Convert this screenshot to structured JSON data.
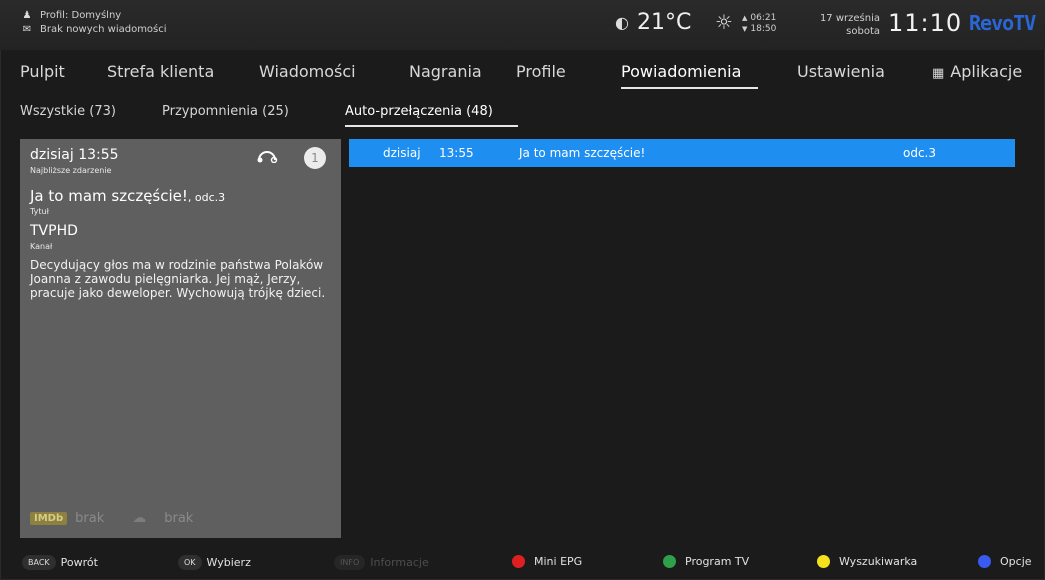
{
  "status": {
    "profile": "Profil: Domyślny",
    "messages": "Brak nowych wiadomości",
    "temperature": "21°C",
    "sunrise": "06:21",
    "sunset": "18:50",
    "date": "17 września",
    "weekday": "sobota",
    "time": "11:10",
    "brand": "RevoTV"
  },
  "nav": {
    "items": [
      "Pulpit",
      "Strefa klienta",
      "Wiadomości",
      "Nagrania",
      "Profile",
      "Powiadomienia",
      "Ustawienia",
      "Aplikacje"
    ],
    "active": "Powiadomienia"
  },
  "subtabs": {
    "items": [
      "Wszystkie (73)",
      "Przypomnienia (25)",
      "Auto-przełączenia (48)"
    ],
    "active": "Auto-przełączenia (48)"
  },
  "detail": {
    "when": "dzisiaj 13:55",
    "when_label": "Najbliższe zdarzenie",
    "title": "Ja to mam szczęście!",
    "episode": ", odc.3",
    "title_label": "Tytuł",
    "channel": "TVPHD",
    "channel_label": "Kanał",
    "description": "Decydujący głos ma w rodzinie państwa Polaków Joanna z zawodu pielęgniarka. Jej mąż, Jerzy, pracuje jako deweloper. Wychowują trójkę dzieci.",
    "badge": "1",
    "imdb_label": "IMDb",
    "imdb_value": "brak",
    "rt_value": "brak"
  },
  "list": {
    "rows": [
      {
        "day": "dzisiaj",
        "time": "13:55",
        "title": "Ja to mam szczęście!",
        "episode": "odc.3"
      }
    ]
  },
  "hints": {
    "back_key": "BACK",
    "back": "Powrót",
    "ok_key": "OK",
    "ok": "Wybierz",
    "info_key": "INFO",
    "info": "Informacje",
    "red": "Mini EPG",
    "green": "Program TV",
    "yellow": "Wyszukiwarka",
    "blue": "Opcje"
  },
  "colors": {
    "accent": "#1e8ef0",
    "red": "#e02020",
    "green": "#2fa04a",
    "yellow": "#f3e21c",
    "blue": "#3a5bf0"
  }
}
